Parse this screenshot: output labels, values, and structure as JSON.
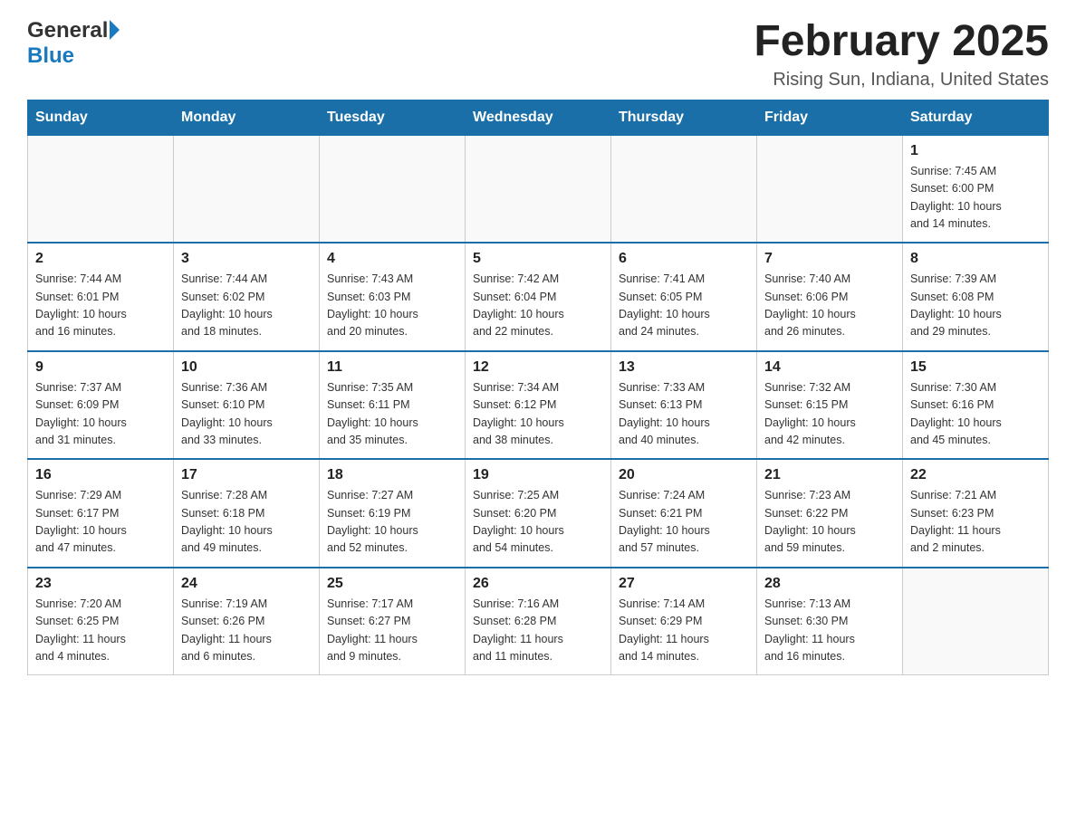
{
  "header": {
    "logo_general": "General",
    "logo_blue": "Blue",
    "month_title": "February 2025",
    "location": "Rising Sun, Indiana, United States"
  },
  "days_of_week": [
    "Sunday",
    "Monday",
    "Tuesday",
    "Wednesday",
    "Thursday",
    "Friday",
    "Saturday"
  ],
  "weeks": [
    [
      {
        "day": "",
        "info": ""
      },
      {
        "day": "",
        "info": ""
      },
      {
        "day": "",
        "info": ""
      },
      {
        "day": "",
        "info": ""
      },
      {
        "day": "",
        "info": ""
      },
      {
        "day": "",
        "info": ""
      },
      {
        "day": "1",
        "info": "Sunrise: 7:45 AM\nSunset: 6:00 PM\nDaylight: 10 hours\nand 14 minutes."
      }
    ],
    [
      {
        "day": "2",
        "info": "Sunrise: 7:44 AM\nSunset: 6:01 PM\nDaylight: 10 hours\nand 16 minutes."
      },
      {
        "day": "3",
        "info": "Sunrise: 7:44 AM\nSunset: 6:02 PM\nDaylight: 10 hours\nand 18 minutes."
      },
      {
        "day": "4",
        "info": "Sunrise: 7:43 AM\nSunset: 6:03 PM\nDaylight: 10 hours\nand 20 minutes."
      },
      {
        "day": "5",
        "info": "Sunrise: 7:42 AM\nSunset: 6:04 PM\nDaylight: 10 hours\nand 22 minutes."
      },
      {
        "day": "6",
        "info": "Sunrise: 7:41 AM\nSunset: 6:05 PM\nDaylight: 10 hours\nand 24 minutes."
      },
      {
        "day": "7",
        "info": "Sunrise: 7:40 AM\nSunset: 6:06 PM\nDaylight: 10 hours\nand 26 minutes."
      },
      {
        "day": "8",
        "info": "Sunrise: 7:39 AM\nSunset: 6:08 PM\nDaylight: 10 hours\nand 29 minutes."
      }
    ],
    [
      {
        "day": "9",
        "info": "Sunrise: 7:37 AM\nSunset: 6:09 PM\nDaylight: 10 hours\nand 31 minutes."
      },
      {
        "day": "10",
        "info": "Sunrise: 7:36 AM\nSunset: 6:10 PM\nDaylight: 10 hours\nand 33 minutes."
      },
      {
        "day": "11",
        "info": "Sunrise: 7:35 AM\nSunset: 6:11 PM\nDaylight: 10 hours\nand 35 minutes."
      },
      {
        "day": "12",
        "info": "Sunrise: 7:34 AM\nSunset: 6:12 PM\nDaylight: 10 hours\nand 38 minutes."
      },
      {
        "day": "13",
        "info": "Sunrise: 7:33 AM\nSunset: 6:13 PM\nDaylight: 10 hours\nand 40 minutes."
      },
      {
        "day": "14",
        "info": "Sunrise: 7:32 AM\nSunset: 6:15 PM\nDaylight: 10 hours\nand 42 minutes."
      },
      {
        "day": "15",
        "info": "Sunrise: 7:30 AM\nSunset: 6:16 PM\nDaylight: 10 hours\nand 45 minutes."
      }
    ],
    [
      {
        "day": "16",
        "info": "Sunrise: 7:29 AM\nSunset: 6:17 PM\nDaylight: 10 hours\nand 47 minutes."
      },
      {
        "day": "17",
        "info": "Sunrise: 7:28 AM\nSunset: 6:18 PM\nDaylight: 10 hours\nand 49 minutes."
      },
      {
        "day": "18",
        "info": "Sunrise: 7:27 AM\nSunset: 6:19 PM\nDaylight: 10 hours\nand 52 minutes."
      },
      {
        "day": "19",
        "info": "Sunrise: 7:25 AM\nSunset: 6:20 PM\nDaylight: 10 hours\nand 54 minutes."
      },
      {
        "day": "20",
        "info": "Sunrise: 7:24 AM\nSunset: 6:21 PM\nDaylight: 10 hours\nand 57 minutes."
      },
      {
        "day": "21",
        "info": "Sunrise: 7:23 AM\nSunset: 6:22 PM\nDaylight: 10 hours\nand 59 minutes."
      },
      {
        "day": "22",
        "info": "Sunrise: 7:21 AM\nSunset: 6:23 PM\nDaylight: 11 hours\nand 2 minutes."
      }
    ],
    [
      {
        "day": "23",
        "info": "Sunrise: 7:20 AM\nSunset: 6:25 PM\nDaylight: 11 hours\nand 4 minutes."
      },
      {
        "day": "24",
        "info": "Sunrise: 7:19 AM\nSunset: 6:26 PM\nDaylight: 11 hours\nand 6 minutes."
      },
      {
        "day": "25",
        "info": "Sunrise: 7:17 AM\nSunset: 6:27 PM\nDaylight: 11 hours\nand 9 minutes."
      },
      {
        "day": "26",
        "info": "Sunrise: 7:16 AM\nSunset: 6:28 PM\nDaylight: 11 hours\nand 11 minutes."
      },
      {
        "day": "27",
        "info": "Sunrise: 7:14 AM\nSunset: 6:29 PM\nDaylight: 11 hours\nand 14 minutes."
      },
      {
        "day": "28",
        "info": "Sunrise: 7:13 AM\nSunset: 6:30 PM\nDaylight: 11 hours\nand 16 minutes."
      },
      {
        "day": "",
        "info": ""
      }
    ]
  ]
}
